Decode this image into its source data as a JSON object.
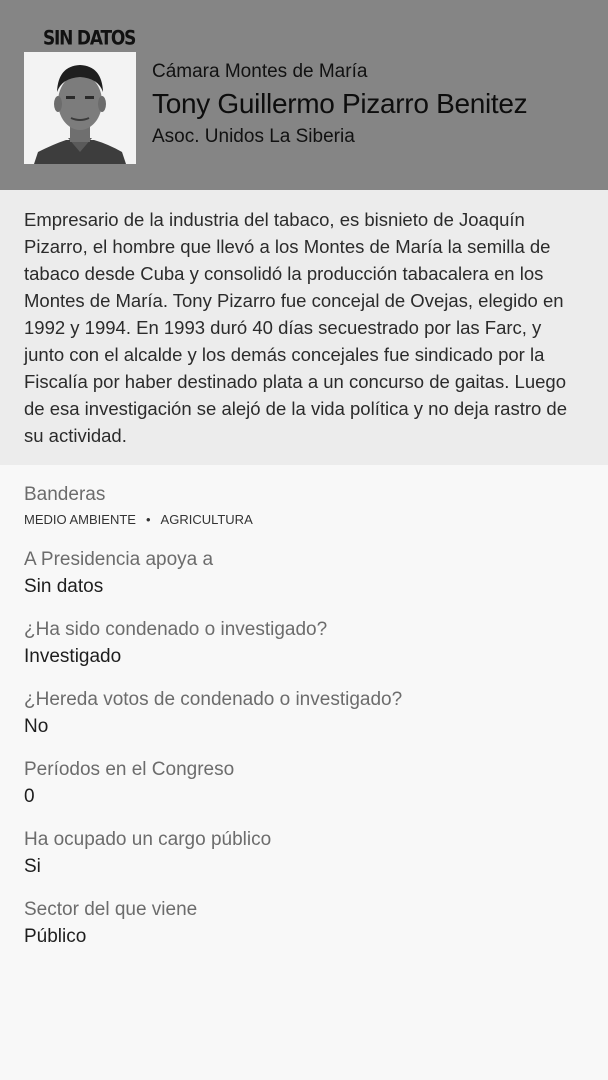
{
  "header": {
    "badge": "SIN DATOS",
    "chamber": "Cámara Montes de María",
    "name": "Tony Guillermo Pizarro Benitez",
    "party": "Asoc. Unidos La Siberia",
    "background_color": "#858585"
  },
  "bio": "Empresario de la industria del tabaco, es bisnieto de Joaquín Pizarro, el hombre que llevó a los Montes de María la semilla de tabaco desde Cuba y consolidó la producción tabacalera en los Montes de María. Tony Pizarro fue concejal de Ovejas, elegido en 1992 y 1994. En 1993 duró 40 días secuestrado por las Farc, y junto con el alcalde y los demás concejales fue sindicado por la Fiscalía por haber destinado plata a un concurso de gaitas. Luego de esa investigación se alejó de la vida política y no deja rastro de su actividad.",
  "banderas": {
    "label": "Banderas",
    "items": [
      "MEDIO AMBIENTE",
      "AGRICULTURA"
    ],
    "separator": "•"
  },
  "fields": [
    {
      "label": "A Presidencia apoya a",
      "value": "Sin datos"
    },
    {
      "label": "¿Ha sido condenado o investigado?",
      "value": "Investigado"
    },
    {
      "label": "¿Hereda votos de condenado o investigado?",
      "value": "No"
    },
    {
      "label": "Períodos en el Congreso",
      "value": "0"
    },
    {
      "label": "Ha ocupado un cargo público",
      "value": "Si"
    },
    {
      "label": "Sector del que viene",
      "value": "Público"
    }
  ]
}
